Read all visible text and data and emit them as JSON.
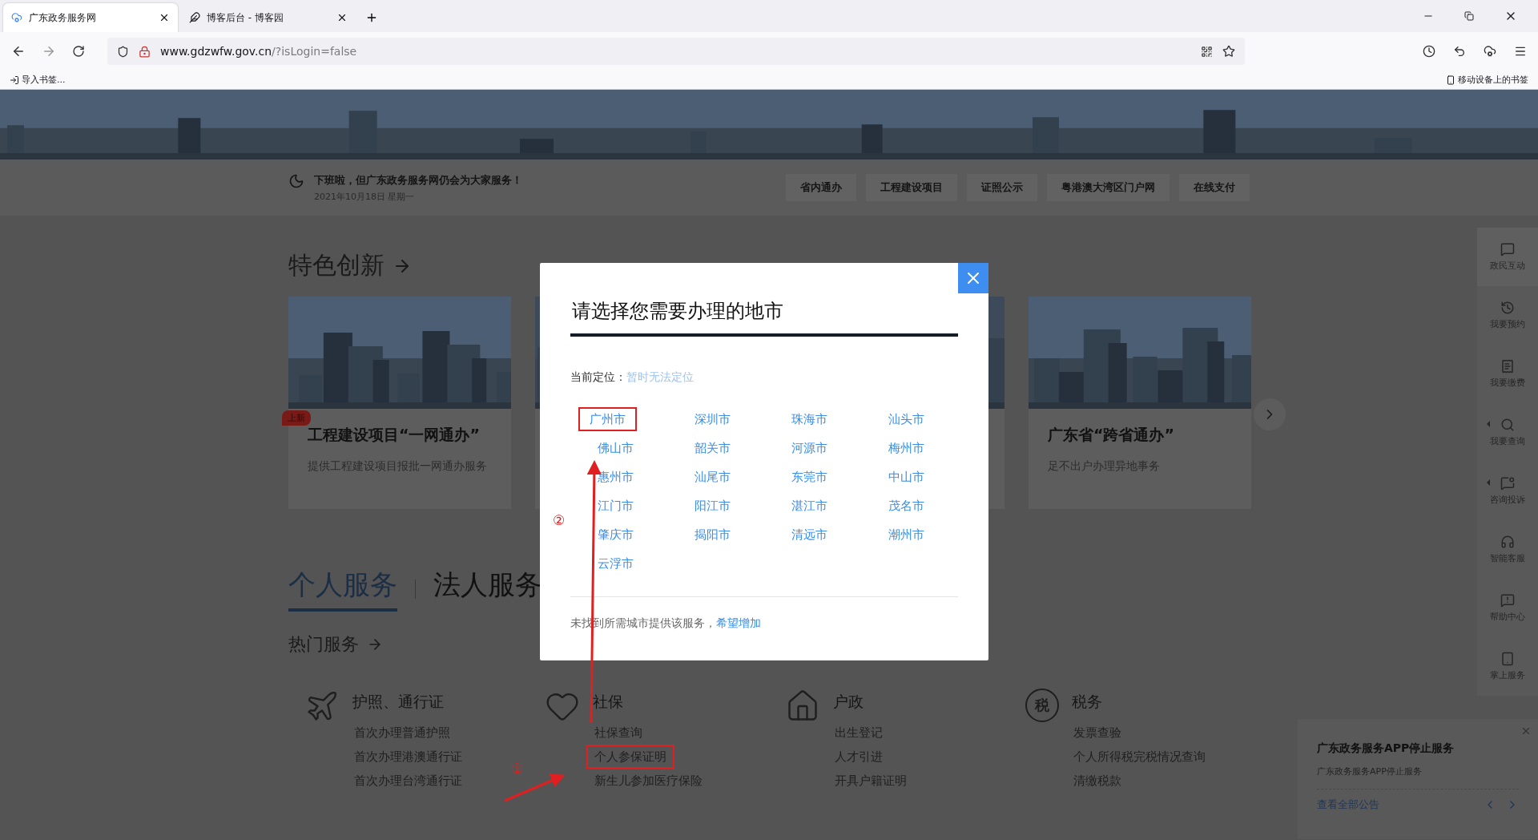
{
  "browser": {
    "tabs": [
      {
        "title": "广东政务服务网",
        "selected": true
      },
      {
        "title": "博客后台 - 博客园",
        "selected": false
      }
    ],
    "url_host": "www.gdzwfw.gov.cn",
    "url_path": "/?isLogin=false",
    "bookmarks_left": "导入书签...",
    "bookmarks_right": "移动设备上的书签"
  },
  "header": {
    "greeting": "下班啦，但广东政务服务网仍会为大家服务！",
    "date": "2021年10月18日 星期一",
    "nav_links": [
      "省内通办",
      "工程建设项目",
      "证照公示",
      "粤港澳大湾区门户网",
      "在线支付"
    ]
  },
  "featured": {
    "title": "特色创新",
    "cards": [
      {
        "kind": "card",
        "badge": "上新",
        "title": "工程建设项目“一网通办”",
        "description": "提供工程建设项目报批一网通办服务"
      },
      {
        "kind": "picture"
      },
      {
        "kind": "picture"
      },
      {
        "kind": "card",
        "title": "广东省“跨省通办”",
        "description": "足不出户办理异地事务"
      }
    ]
  },
  "service_tabs": [
    {
      "label": "个人服务",
      "selected": true
    },
    {
      "label": "法人服务",
      "selected": false
    }
  ],
  "hot_services": {
    "title": "热门服务",
    "categories": [
      {
        "kind": "plane",
        "title": "护照、通行证",
        "items": [
          {
            "label": "首次办理普通护照",
            "highlighted": false
          },
          {
            "label": "首次办理港澳通行证",
            "highlighted": false
          },
          {
            "label": "首次办理台湾通行证",
            "highlighted": false
          }
        ]
      },
      {
        "kind": "heart",
        "title": "社保",
        "items": [
          {
            "label": "社保查询",
            "highlighted": false
          },
          {
            "label": "个人参保证明",
            "highlighted": true
          },
          {
            "label": "新生儿参加医疗保险",
            "highlighted": false
          }
        ]
      },
      {
        "kind": "house",
        "title": "户政",
        "items": [
          {
            "label": "出生登记",
            "highlighted": false
          },
          {
            "label": "人才引进",
            "highlighted": false
          },
          {
            "label": "开具户籍证明",
            "highlighted": false
          }
        ]
      },
      {
        "kind": "tax",
        "icon_text": "税",
        "title": "税务",
        "items": [
          {
            "label": "发票查验",
            "highlighted": false
          },
          {
            "label": "个人所得税完税情况查询",
            "highlighted": false
          },
          {
            "label": "清缴税款",
            "highlighted": false
          }
        ]
      }
    ]
  },
  "sidebar": [
    {
      "kind": "chat",
      "label": "政民互动",
      "has_submenu": false
    },
    {
      "kind": "clock",
      "label": "我要预约",
      "has_submenu": false
    },
    {
      "kind": "payment",
      "label": "我要缴费",
      "has_submenu": false
    },
    {
      "kind": "search",
      "label": "我要查询",
      "has_submenu": true
    },
    {
      "kind": "consult",
      "label": "咨询投诉",
      "has_submenu": true
    },
    {
      "kind": "headset",
      "label": "智能客服",
      "has_submenu": false
    },
    {
      "kind": "help",
      "label": "帮助中心",
      "has_submenu": false
    },
    {
      "kind": "mobile",
      "label": "掌上服务",
      "has_submenu": false
    }
  ],
  "notice": {
    "title": "广东政务服务APP停止服务",
    "text": "广东政务服务APP停止服务",
    "link": "查看全部公告"
  },
  "modal": {
    "title": "请选择您需要办理的地市",
    "location_label": "当前定位：",
    "location_value": "暂时无法定位",
    "cities": [
      {
        "name": "广州市",
        "highlighted": true
      },
      {
        "name": "深圳市",
        "highlighted": false
      },
      {
        "name": "珠海市",
        "highlighted": false
      },
      {
        "name": "汕头市",
        "highlighted": false
      },
      {
        "name": "佛山市",
        "highlighted": false
      },
      {
        "name": "韶关市",
        "highlighted": false
      },
      {
        "name": "河源市",
        "highlighted": false
      },
      {
        "name": "梅州市",
        "highlighted": false
      },
      {
        "name": "惠州市",
        "highlighted": false
      },
      {
        "name": "汕尾市",
        "highlighted": false
      },
      {
        "name": "东莞市",
        "highlighted": false
      },
      {
        "name": "中山市",
        "highlighted": false
      },
      {
        "name": "江门市",
        "highlighted": false
      },
      {
        "name": "阳江市",
        "highlighted": false
      },
      {
        "name": "湛江市",
        "highlighted": false
      },
      {
        "name": "茂名市",
        "highlighted": false
      },
      {
        "name": "肇庆市",
        "highlighted": false
      },
      {
        "name": "揭阳市",
        "highlighted": false
      },
      {
        "name": "清远市",
        "highlighted": false
      },
      {
        "name": "潮州市",
        "highlighted": false
      },
      {
        "name": "云浮市",
        "highlighted": false
      }
    ],
    "footer_text": "未找到所需城市提供该服务，",
    "footer_link": "希望增加"
  },
  "annotations": [
    "①",
    "②"
  ]
}
